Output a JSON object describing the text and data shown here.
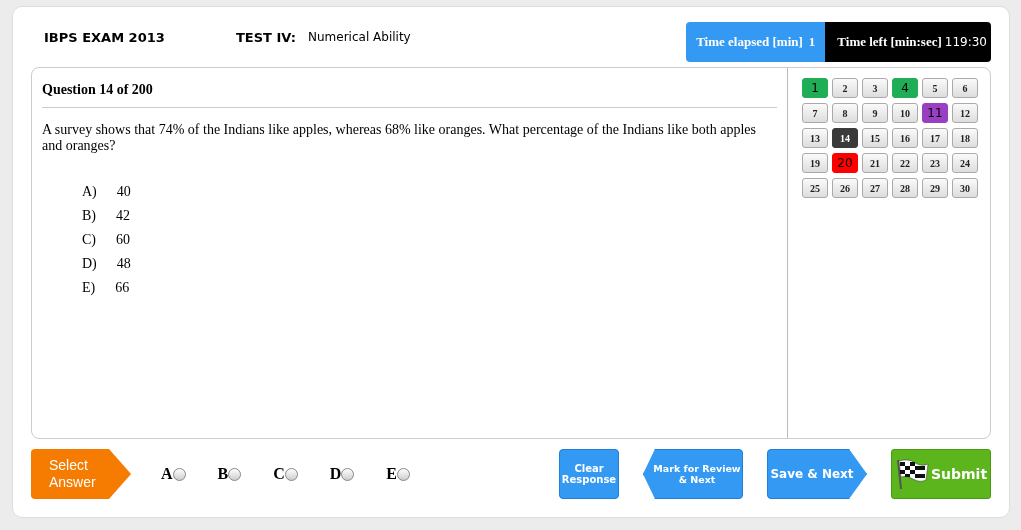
{
  "header": {
    "exam_title": "IBPS EXAM 2013",
    "test_label": "TEST IV:",
    "test_name": "Numerical Ability",
    "time_elapsed_label": "Time elapsed [min]",
    "time_elapsed": "1",
    "time_left_label": "Time left [min:sec]",
    "time_left": "119:30"
  },
  "question": {
    "heading": "Question 14 of 200",
    "text": "A survey shows that 74% of the Indians like apples, whereas 68% like oranges. What percentage of the Indians like both apples and oranges?",
    "options": [
      {
        "letter": "A)",
        "value": "40"
      },
      {
        "letter": "B)",
        "value": "42"
      },
      {
        "letter": "C)",
        "value": "60"
      },
      {
        "letter": "D)",
        "value": "48"
      },
      {
        "letter": "E)",
        "value": "66"
      }
    ]
  },
  "palette": [
    {
      "number": "1",
      "kind": "answered",
      "selected": false
    },
    {
      "number": "2",
      "kind": "not_visited",
      "selected": false
    },
    {
      "number": "3",
      "kind": "not_visited",
      "selected": false
    },
    {
      "number": "4",
      "kind": "answered",
      "selected": false
    },
    {
      "number": "5",
      "kind": "not_visited",
      "selected": false
    },
    {
      "number": "6",
      "kind": "not_visited",
      "selected": false
    },
    {
      "number": "7",
      "kind": "not_visited",
      "selected": false
    },
    {
      "number": "8",
      "kind": "not_visited",
      "selected": false
    },
    {
      "number": "9",
      "kind": "not_visited",
      "selected": false
    },
    {
      "number": "10",
      "kind": "not_visited",
      "selected": false
    },
    {
      "number": "11",
      "kind": "review",
      "selected": false
    },
    {
      "number": "12",
      "kind": "not_visited",
      "selected": false
    },
    {
      "number": "13",
      "kind": "not_visited",
      "selected": false
    },
    {
      "number": "14",
      "kind": "not_visited",
      "selected": true
    },
    {
      "number": "15",
      "kind": "not_visited",
      "selected": false
    },
    {
      "number": "16",
      "kind": "not_visited",
      "selected": false
    },
    {
      "number": "17",
      "kind": "not_visited",
      "selected": false
    },
    {
      "number": "18",
      "kind": "not_visited",
      "selected": false
    },
    {
      "number": "19",
      "kind": "not_visited",
      "selected": false
    },
    {
      "number": "20",
      "kind": "not_answered",
      "selected": false
    },
    {
      "number": "21",
      "kind": "not_visited",
      "selected": false
    },
    {
      "number": "22",
      "kind": "not_visited",
      "selected": false
    },
    {
      "number": "23",
      "kind": "not_visited",
      "selected": false
    },
    {
      "number": "24",
      "kind": "not_visited",
      "selected": false
    },
    {
      "number": "25",
      "kind": "not_visited",
      "selected": false
    },
    {
      "number": "26",
      "kind": "not_visited",
      "selected": false
    },
    {
      "number": "27",
      "kind": "not_visited",
      "selected": false
    },
    {
      "number": "28",
      "kind": "not_visited",
      "selected": false
    },
    {
      "number": "29",
      "kind": "not_visited",
      "selected": false
    },
    {
      "number": "30",
      "kind": "not_visited",
      "selected": false
    }
  ],
  "answer_bar": {
    "label": "Select Answer",
    "choices": [
      {
        "letter": "A",
        "selected": false
      },
      {
        "letter": "B",
        "selected": false
      },
      {
        "letter": "C",
        "selected": false
      },
      {
        "letter": "D",
        "selected": false
      },
      {
        "letter": "E",
        "selected": false
      }
    ]
  },
  "actions": {
    "clear": "Clear Response",
    "mark_review": "Mark for Review & Next",
    "save_next": "Save & Next",
    "submit": "Submit"
  }
}
